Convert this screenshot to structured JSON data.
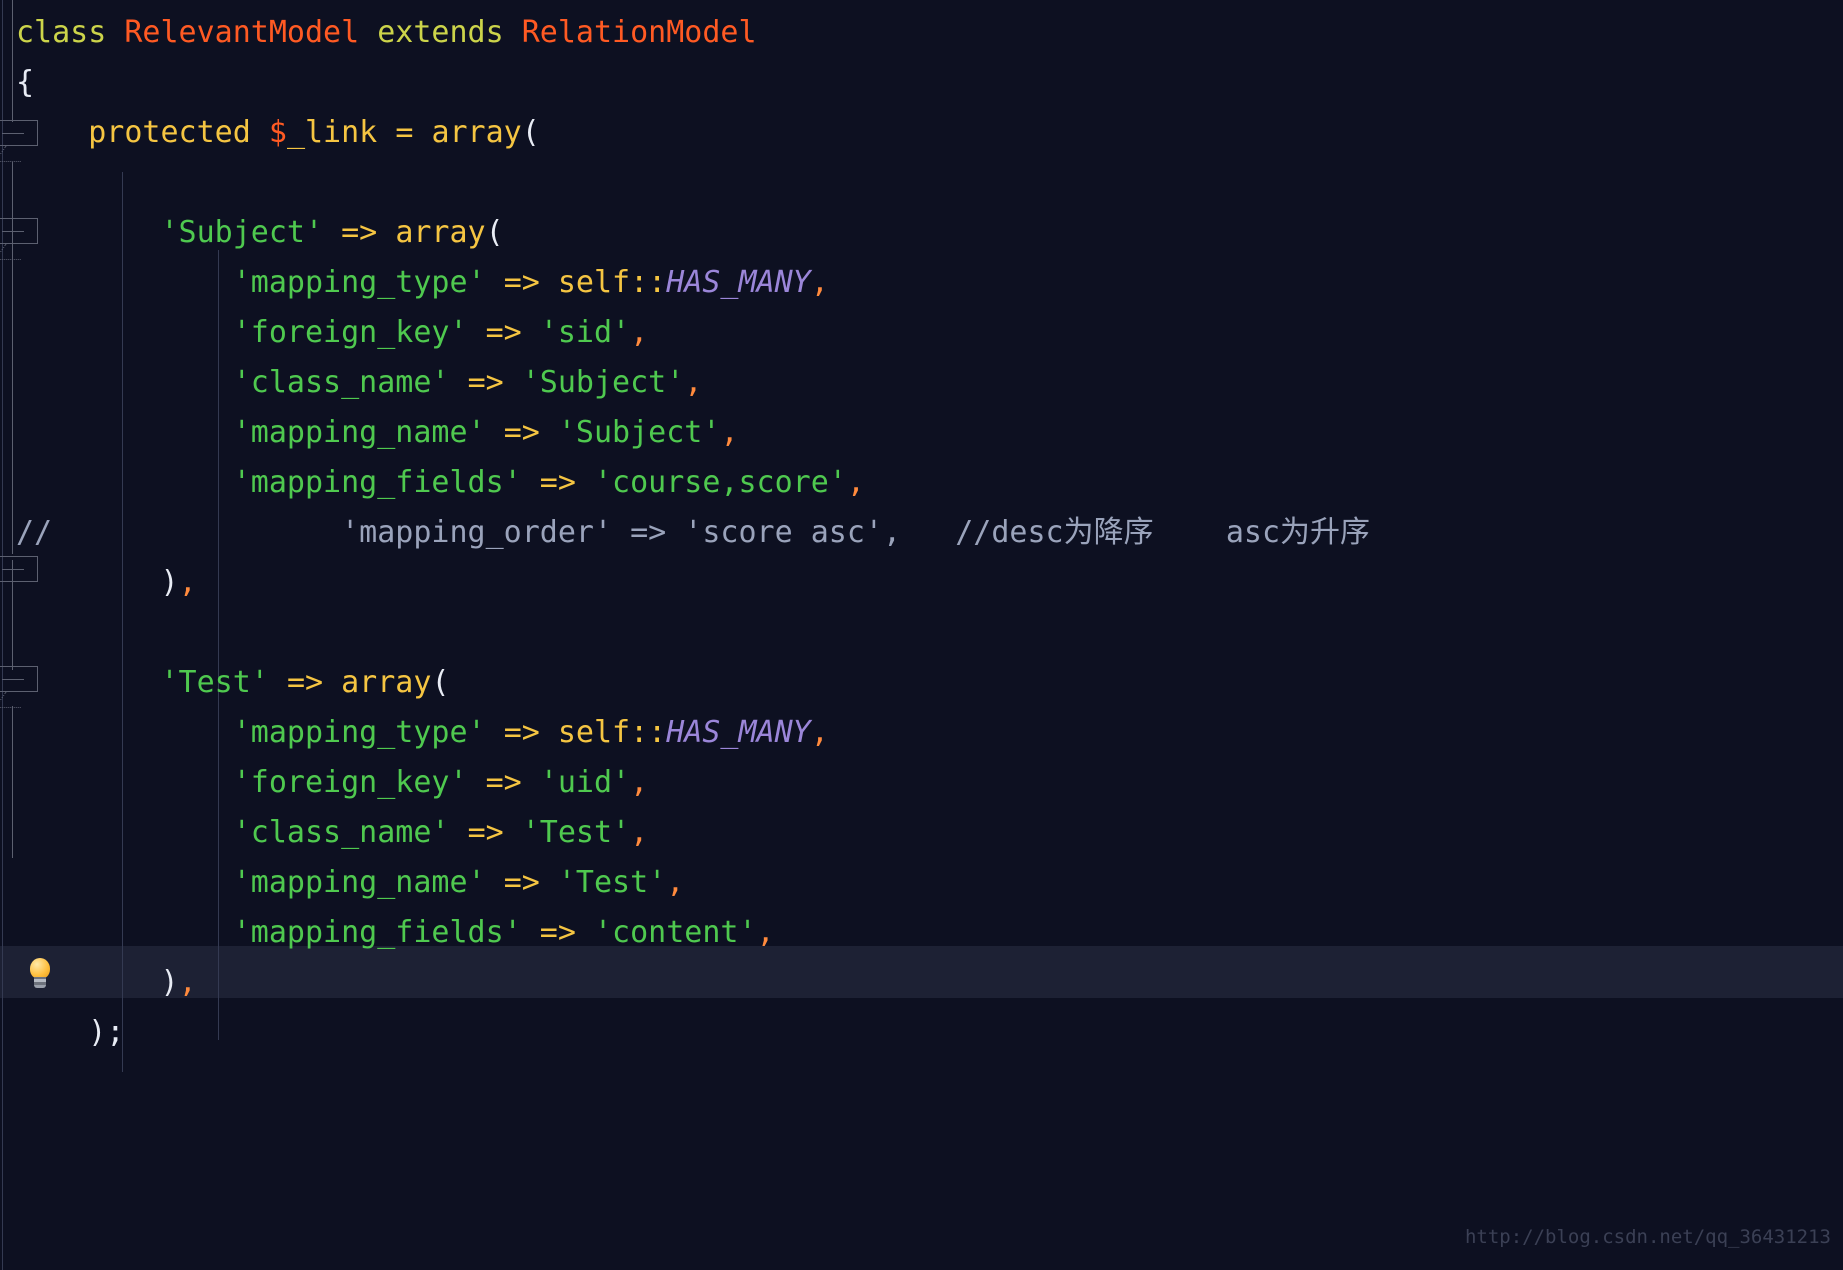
{
  "editor": {
    "language": "php",
    "background_color": "#0d1021",
    "current_line_color": "#1d2134",
    "indent_guide_color": "#343a52",
    "colors": {
      "keyword": "#ccd44a",
      "class_name": "#ff5a23",
      "variable": "#f5c542",
      "string": "#4fc94f",
      "operator": "#f5c542",
      "comma": "#ff8a3d",
      "constant": "#9b86d9",
      "comment": "#9aa3bb",
      "punctuation": "#e8ecf5"
    }
  },
  "gutter": {
    "intention_bulb_icon": "lightbulb-icon",
    "fold_markers": [
      "fold-expanded",
      "fold-expanded",
      "fold-collapsed-end",
      "fold-expanded",
      "fold-collapsed-end"
    ]
  },
  "code": {
    "lines": [
      {
        "indent": 0,
        "tokens": [
          {
            "t": "class",
            "c": "kw"
          },
          {
            "t": " ",
            "c": "punct"
          },
          {
            "t": "RelevantModel",
            "c": "cls"
          },
          {
            "t": " ",
            "c": "punct"
          },
          {
            "t": "extends",
            "c": "kw"
          },
          {
            "t": " ",
            "c": "punct"
          },
          {
            "t": "RelationModel",
            "c": "cls"
          }
        ]
      },
      {
        "indent": 0,
        "tokens": [
          {
            "t": "{",
            "c": "punct"
          }
        ]
      },
      {
        "indent": 0,
        "tokens": [
          {
            "t": "    ",
            "c": "punct"
          },
          {
            "t": "protected",
            "c": "var"
          },
          {
            "t": " ",
            "c": "punct"
          },
          {
            "t": "$",
            "c": "cls"
          },
          {
            "t": "_link",
            "c": "var"
          },
          {
            "t": " ",
            "c": "punct"
          },
          {
            "t": "=",
            "c": "op"
          },
          {
            "t": " ",
            "c": "punct"
          },
          {
            "t": "array",
            "c": "op"
          },
          {
            "t": "(",
            "c": "punct"
          }
        ]
      },
      {
        "indent": 0,
        "tokens": []
      },
      {
        "indent": 0,
        "tokens": [
          {
            "t": "        ",
            "c": "punct"
          },
          {
            "t": "'Subject'",
            "c": "str"
          },
          {
            "t": " ",
            "c": "punct"
          },
          {
            "t": "=>",
            "c": "op"
          },
          {
            "t": " ",
            "c": "punct"
          },
          {
            "t": "array",
            "c": "op"
          },
          {
            "t": "(",
            "c": "punct"
          }
        ]
      },
      {
        "indent": 0,
        "tokens": [
          {
            "t": "            ",
            "c": "punct"
          },
          {
            "t": "'mapping_type'",
            "c": "str"
          },
          {
            "t": " ",
            "c": "punct"
          },
          {
            "t": "=>",
            "c": "op"
          },
          {
            "t": " ",
            "c": "punct"
          },
          {
            "t": "self",
            "c": "op"
          },
          {
            "t": "::",
            "c": "op"
          },
          {
            "t": "HAS_MANY",
            "c": "const"
          },
          {
            "t": ",",
            "c": "comma"
          }
        ]
      },
      {
        "indent": 0,
        "tokens": [
          {
            "t": "            ",
            "c": "punct"
          },
          {
            "t": "'foreign_key'",
            "c": "str"
          },
          {
            "t": " ",
            "c": "punct"
          },
          {
            "t": "=>",
            "c": "op"
          },
          {
            "t": " ",
            "c": "punct"
          },
          {
            "t": "'sid'",
            "c": "str"
          },
          {
            "t": ",",
            "c": "comma"
          }
        ]
      },
      {
        "indent": 0,
        "tokens": [
          {
            "t": "            ",
            "c": "punct"
          },
          {
            "t": "'class_name'",
            "c": "str"
          },
          {
            "t": " ",
            "c": "punct"
          },
          {
            "t": "=>",
            "c": "op"
          },
          {
            "t": " ",
            "c": "punct"
          },
          {
            "t": "'Subject'",
            "c": "str"
          },
          {
            "t": ",",
            "c": "comma"
          }
        ]
      },
      {
        "indent": 0,
        "tokens": [
          {
            "t": "            ",
            "c": "punct"
          },
          {
            "t": "'mapping_name'",
            "c": "str"
          },
          {
            "t": " ",
            "c": "punct"
          },
          {
            "t": "=>",
            "c": "op"
          },
          {
            "t": " ",
            "c": "punct"
          },
          {
            "t": "'Subject'",
            "c": "str"
          },
          {
            "t": ",",
            "c": "comma"
          }
        ]
      },
      {
        "indent": 0,
        "tokens": [
          {
            "t": "            ",
            "c": "punct"
          },
          {
            "t": "'mapping_fields'",
            "c": "str"
          },
          {
            "t": " ",
            "c": "punct"
          },
          {
            "t": "=>",
            "c": "op"
          },
          {
            "t": " ",
            "c": "punct"
          },
          {
            "t": "'course,score'",
            "c": "str"
          },
          {
            "t": ",",
            "c": "comma"
          }
        ]
      },
      {
        "indent": 0,
        "tokens": [
          {
            "t": "//",
            "c": "comment"
          },
          {
            "t": "                'mapping_order' => 'score asc',   //desc为降序    asc为升序",
            "c": "comment"
          }
        ]
      },
      {
        "indent": 0,
        "tokens": [
          {
            "t": "        ",
            "c": "punct"
          },
          {
            "t": ")",
            "c": "punct"
          },
          {
            "t": ",",
            "c": "comma"
          }
        ]
      },
      {
        "indent": 0,
        "tokens": []
      },
      {
        "indent": 0,
        "tokens": [
          {
            "t": "        ",
            "c": "punct"
          },
          {
            "t": "'Test'",
            "c": "str"
          },
          {
            "t": " ",
            "c": "punct"
          },
          {
            "t": "=>",
            "c": "op"
          },
          {
            "t": " ",
            "c": "punct"
          },
          {
            "t": "array",
            "c": "op"
          },
          {
            "t": "(",
            "c": "punct"
          }
        ]
      },
      {
        "indent": 0,
        "tokens": [
          {
            "t": "            ",
            "c": "punct"
          },
          {
            "t": "'mapping_type'",
            "c": "str"
          },
          {
            "t": " ",
            "c": "punct"
          },
          {
            "t": "=>",
            "c": "op"
          },
          {
            "t": " ",
            "c": "punct"
          },
          {
            "t": "self",
            "c": "op"
          },
          {
            "t": "::",
            "c": "op"
          },
          {
            "t": "HAS_MANY",
            "c": "const"
          },
          {
            "t": ",",
            "c": "comma"
          }
        ]
      },
      {
        "indent": 0,
        "tokens": [
          {
            "t": "            ",
            "c": "punct"
          },
          {
            "t": "'foreign_key'",
            "c": "str"
          },
          {
            "t": " ",
            "c": "punct"
          },
          {
            "t": "=>",
            "c": "op"
          },
          {
            "t": " ",
            "c": "punct"
          },
          {
            "t": "'uid'",
            "c": "str"
          },
          {
            "t": ",",
            "c": "comma"
          }
        ]
      },
      {
        "indent": 0,
        "highlight": true,
        "tokens": [
          {
            "t": "            ",
            "c": "punct"
          },
          {
            "t": "'class_name'",
            "c": "str"
          },
          {
            "t": " ",
            "c": "punct"
          },
          {
            "t": "=>",
            "c": "op"
          },
          {
            "t": " ",
            "c": "punct"
          },
          {
            "t": "'Test'",
            "c": "str"
          },
          {
            "t": ",",
            "c": "comma"
          }
        ]
      },
      {
        "indent": 0,
        "tokens": [
          {
            "t": "            ",
            "c": "punct"
          },
          {
            "t": "'mapping_name'",
            "c": "str"
          },
          {
            "t": " ",
            "c": "punct"
          },
          {
            "t": "=>",
            "c": "op"
          },
          {
            "t": " ",
            "c": "punct"
          },
          {
            "t": "'Test'",
            "c": "str"
          },
          {
            "t": ",",
            "c": "comma"
          }
        ]
      },
      {
        "indent": 0,
        "tokens": [
          {
            "t": "            ",
            "c": "punct"
          },
          {
            "t": "'mapping_fields'",
            "c": "str"
          },
          {
            "t": " ",
            "c": "punct"
          },
          {
            "t": "=>",
            "c": "op"
          },
          {
            "t": " ",
            "c": "punct"
          },
          {
            "t": "'content'",
            "c": "str"
          },
          {
            "t": ",",
            "c": "comma"
          }
        ]
      },
      {
        "indent": 0,
        "tokens": [
          {
            "t": "        ",
            "c": "punct"
          },
          {
            "t": ")",
            "c": "punct"
          },
          {
            "t": ",",
            "c": "comma"
          }
        ]
      },
      {
        "indent": 0,
        "tokens": [
          {
            "t": "    ",
            "c": "punct"
          },
          {
            "t": ")",
            "c": "punct"
          },
          {
            "t": ";",
            "c": "punct"
          }
        ]
      }
    ]
  },
  "watermark": {
    "text": "http://blog.csdn.net/qq_36431213"
  }
}
